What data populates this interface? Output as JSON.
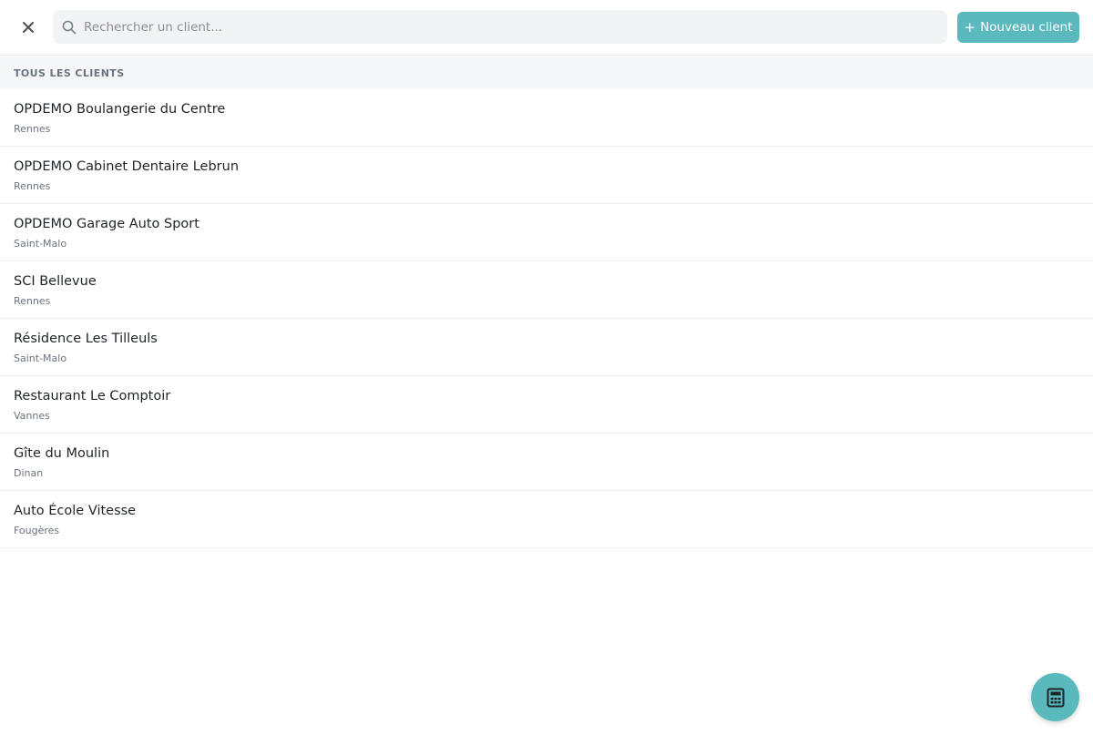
{
  "header": {
    "search": {
      "placeholder": "Rechercher un client..."
    },
    "new_client_label": "Nouveau client",
    "close_icon": "close-icon",
    "search_icon": "search-icon",
    "plus_icon": "plus-icon"
  },
  "section": {
    "title": "TOUS LES CLIENTS"
  },
  "clients": [
    {
      "name": "OPDEMO Boulangerie du Centre",
      "city": "Rennes"
    },
    {
      "name": "OPDEMO Cabinet Dentaire Lebrun",
      "city": "Rennes"
    },
    {
      "name": "OPDEMO Garage Auto Sport",
      "city": "Saint-Malo"
    },
    {
      "name": "SCI Bellevue",
      "city": "Rennes"
    },
    {
      "name": "Résidence Les Tilleuls",
      "city": "Saint-Malo"
    },
    {
      "name": "Restaurant Le Comptoir",
      "city": "Vannes"
    },
    {
      "name": "Gîte du Moulin",
      "city": "Dinan"
    },
    {
      "name": "Auto École Vitesse",
      "city": "Fougères"
    }
  ],
  "fab": {
    "icon": "calculator-icon"
  },
  "colors": {
    "accent": "#5ab9bd",
    "section_bg": "#f6f7f9",
    "search_bg": "#f2f3f5",
    "text_primary": "#1f2328",
    "text_secondary": "#6b7280"
  }
}
